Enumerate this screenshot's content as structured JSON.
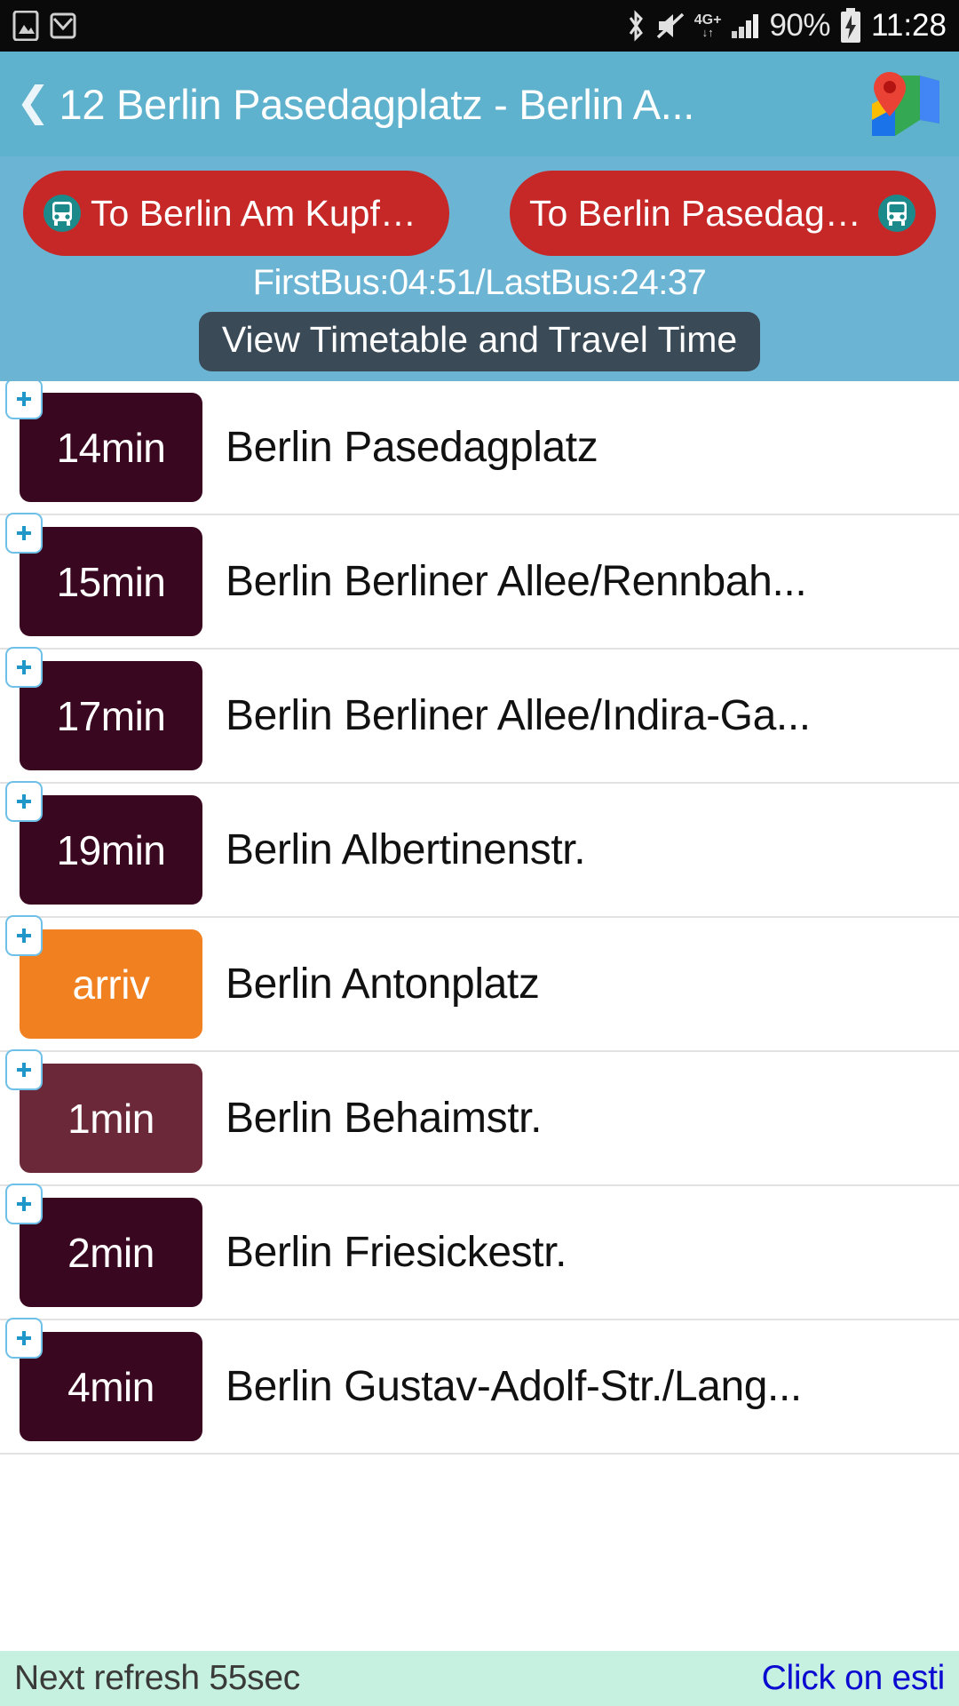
{
  "statusbar": {
    "left_icons": [
      "gallery-icon",
      "gmail-icon"
    ],
    "right_icons": [
      "bluetooth-icon",
      "mute-icon",
      "network-4gplus-icon",
      "signal-icon",
      "battery-charging-icon"
    ],
    "network": "4G+",
    "battery_percent": "90%",
    "time": "11:28",
    "bg_color": "#0a0a0a"
  },
  "titlebar": {
    "back_label": "❮",
    "title": "12 Berlin Pasedagplatz - Berlin A...",
    "map_icon": "google-maps-icon",
    "bg_color": "#5fb2cd"
  },
  "directions": {
    "bg_color": "#6cb4d4",
    "button_color": "#c62828",
    "left_button": {
      "label": "To Berlin Am Kupferg...",
      "icon": "bus-icon"
    },
    "right_button": {
      "label": "To Berlin Pasedagplatz",
      "icon": "bus-icon"
    },
    "first_last_bus": "FirstBus:04:51/LastBus:24:37",
    "timetable_button": "View Timetable and Travel Time",
    "timetable_button_color": "#3a4b57"
  },
  "stops": [
    {
      "eta": "14min",
      "name": "Berlin Pasedagplatz",
      "badge_color": "#3a0720",
      "add_icon": "plus-icon"
    },
    {
      "eta": "15min",
      "name": "Berlin Berliner Allee/Rennbah...",
      "badge_color": "#3a0720",
      "add_icon": "plus-icon"
    },
    {
      "eta": "17min",
      "name": "Berlin Berliner Allee/Indira-Ga...",
      "badge_color": "#3a0720",
      "add_icon": "plus-icon"
    },
    {
      "eta": "19min",
      "name": "Berlin Albertinenstr.",
      "badge_color": "#3a0720",
      "add_icon": "plus-icon"
    },
    {
      "eta": "arriv",
      "name": "Berlin Antonplatz",
      "badge_color": "#f08020",
      "add_icon": "plus-icon"
    },
    {
      "eta": "1min",
      "name": "Berlin Behaimstr.",
      "badge_color": "#6b2838",
      "add_icon": "plus-icon"
    },
    {
      "eta": "2min",
      "name": "Berlin Friesickestr.",
      "badge_color": "#3a0720",
      "add_icon": "plus-icon"
    },
    {
      "eta": "4min",
      "name": "Berlin Gustav-Adolf-Str./Lang...",
      "badge_color": "#3a0720",
      "add_icon": "plus-icon"
    }
  ],
  "footer": {
    "refresh_text": "Next refresh 55sec",
    "hint_text": "Click on esti",
    "bg_color": "#c6f0e0",
    "hint_color": "#0a0ad0"
  }
}
